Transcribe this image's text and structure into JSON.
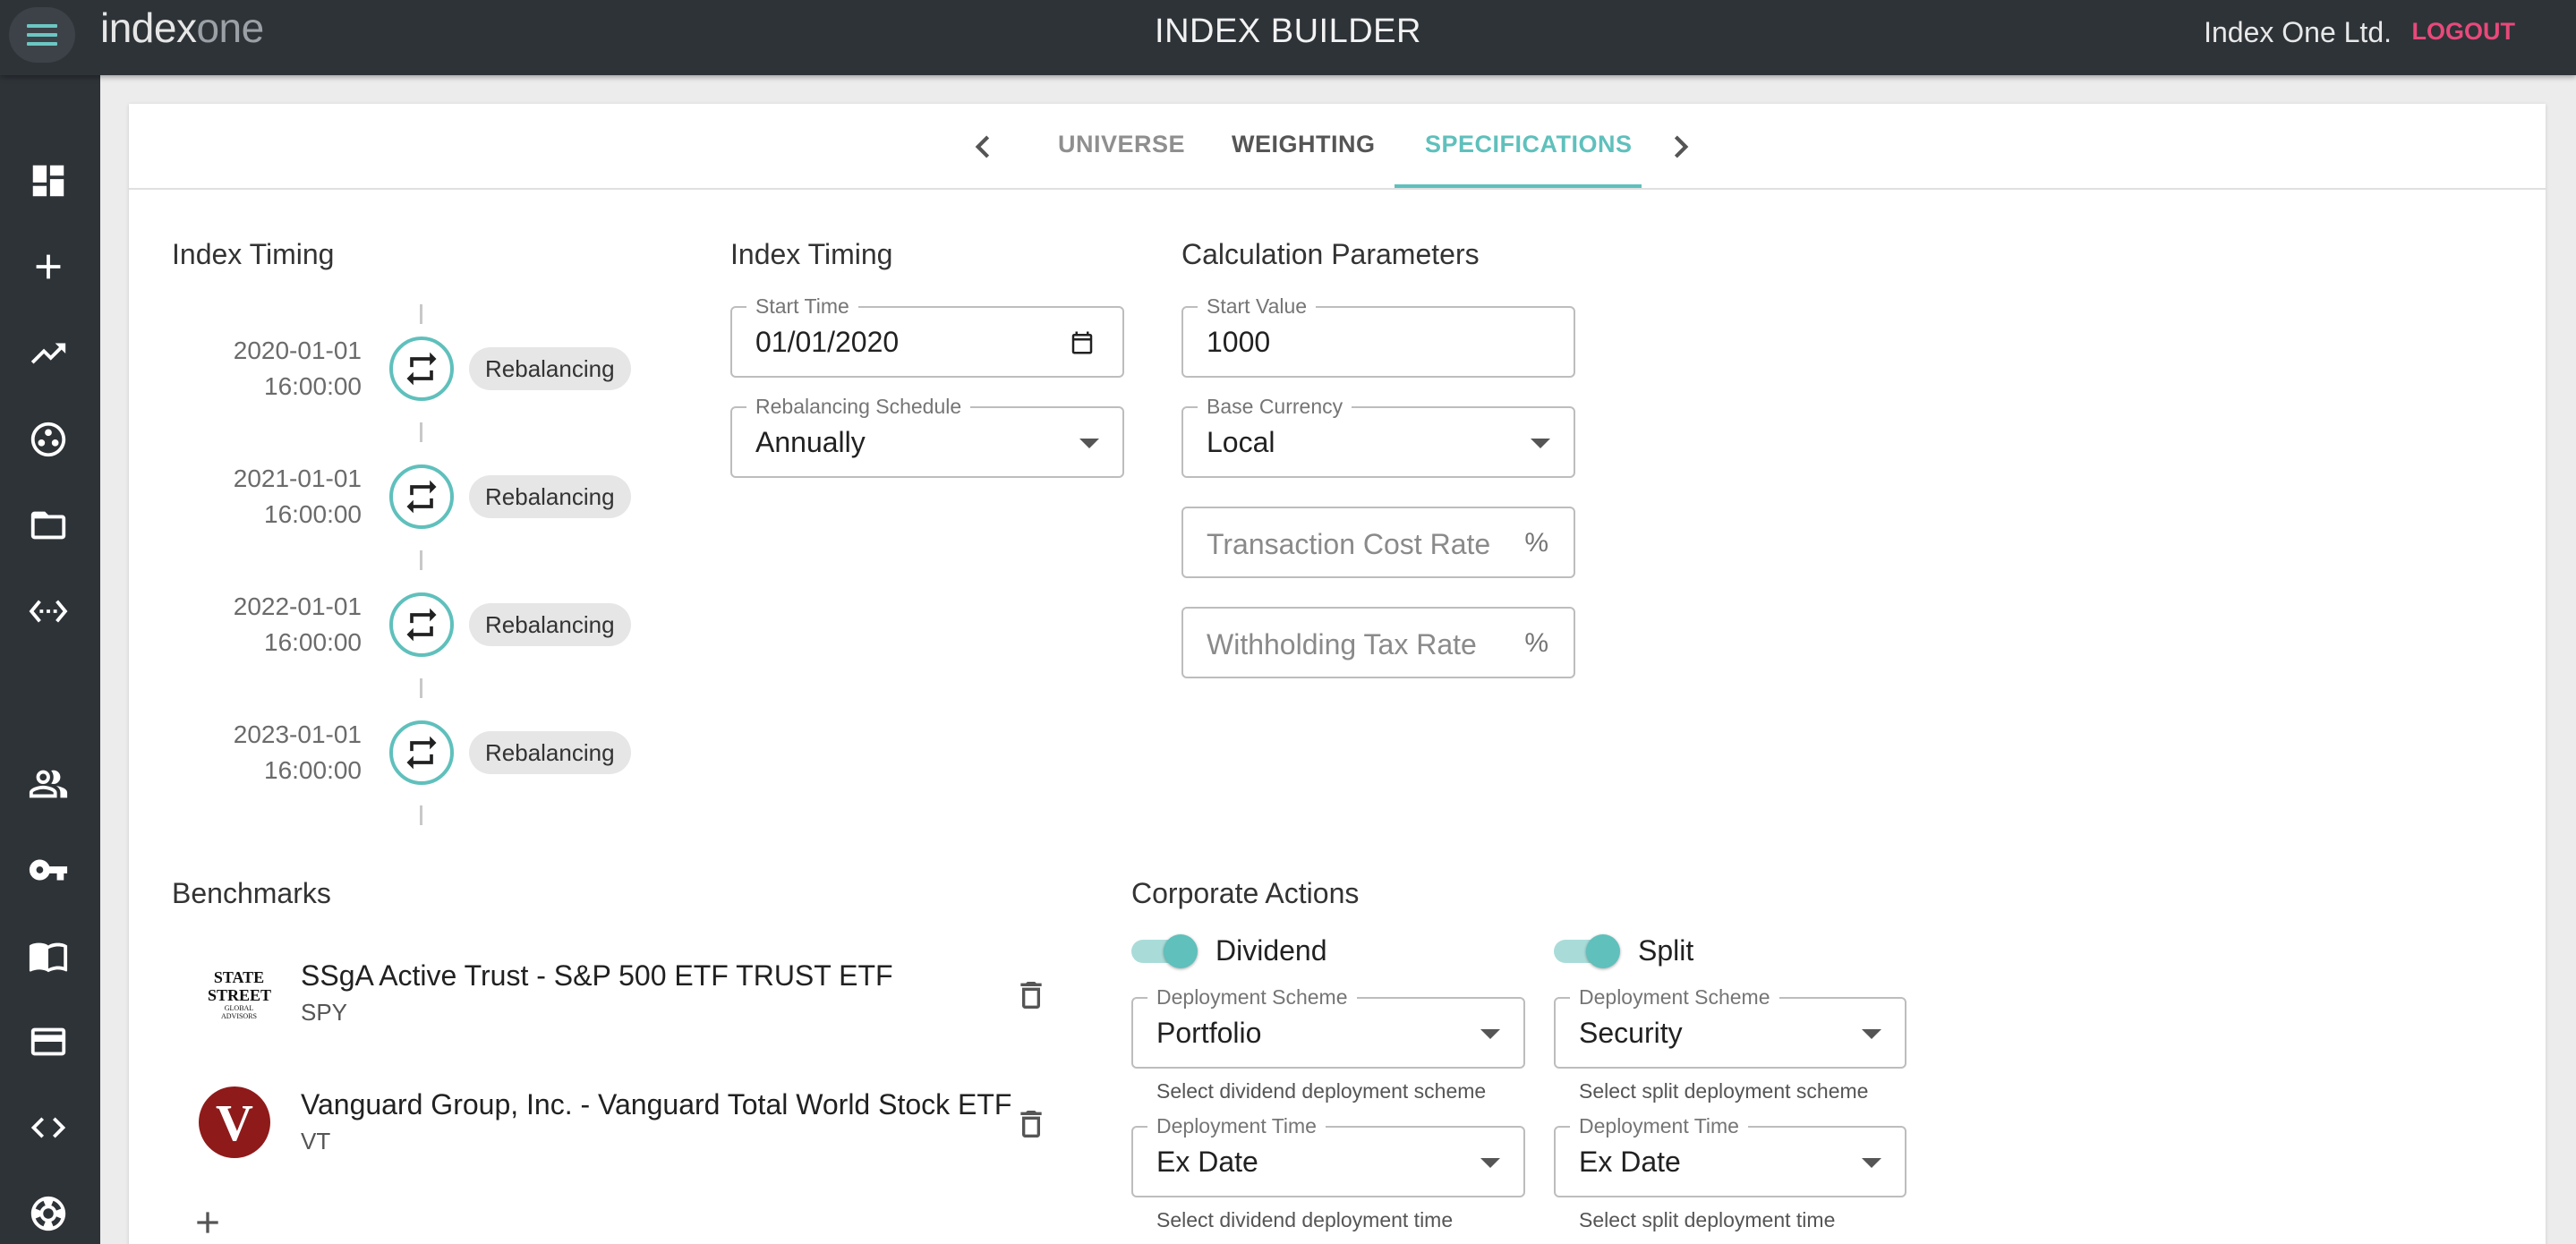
{
  "header": {
    "logo_main": "index",
    "logo_accent": "one",
    "title": "INDEX BUILDER",
    "company": "Index One Ltd.",
    "logout": "LOGOUT"
  },
  "sidebar": {
    "icons": [
      "dashboard-icon",
      "plus-icon",
      "trending-up-icon",
      "hub-icon",
      "folder-icon",
      "api-icon",
      "users-icon",
      "key-icon",
      "book-icon",
      "credit-card-icon",
      "code-icon",
      "support-icon"
    ]
  },
  "tabs": {
    "items": [
      "UNIVERSE",
      "WEIGHTING",
      "SPECIFICATIONS"
    ],
    "active": "SPECIFICATIONS"
  },
  "timeline": {
    "title": "Index Timing",
    "events": [
      {
        "date": "2020-01-01",
        "time": "16:00:00",
        "label": "Rebalancing"
      },
      {
        "date": "2021-01-01",
        "time": "16:00:00",
        "label": "Rebalancing"
      },
      {
        "date": "2022-01-01",
        "time": "16:00:00",
        "label": "Rebalancing"
      },
      {
        "date": "2023-01-01",
        "time": "16:00:00",
        "label": "Rebalancing"
      }
    ]
  },
  "index_timing": {
    "title": "Index Timing",
    "start_time_label": "Start Time",
    "start_time_value": "01/01/2020",
    "schedule_label": "Rebalancing Schedule",
    "schedule_value": "Annually"
  },
  "calc_params": {
    "title": "Calculation Parameters",
    "start_value_label": "Start Value",
    "start_value": "1000",
    "base_currency_label": "Base Currency",
    "base_currency": "Local",
    "transaction_cost_placeholder": "Transaction Cost Rate",
    "withholding_tax_placeholder": "Withholding Tax Rate",
    "percent": "%"
  },
  "benchmarks": {
    "title": "Benchmarks",
    "items": [
      {
        "name": "SSgA Active Trust - S&P 500 ETF TRUST ETF",
        "ticker": "SPY",
        "logo_text_1": "STATE",
        "logo_text_2": "STREET",
        "logo_text_3": "GLOBAL",
        "logo_text_4": "ADVISORS"
      },
      {
        "name": "Vanguard Group, Inc. - Vanguard Total World Stock ETF",
        "ticker": "VT",
        "logo_text_1": "V"
      }
    ]
  },
  "corporate_actions": {
    "title": "Corporate Actions",
    "dividend": {
      "label": "Dividend",
      "enabled": true,
      "scheme_label": "Deployment Scheme",
      "scheme_value": "Portfolio",
      "scheme_helper": "Select dividend deployment scheme",
      "time_label": "Deployment Time",
      "time_value": "Ex Date",
      "time_helper": "Select dividend deployment time"
    },
    "split": {
      "label": "Split",
      "enabled": true,
      "scheme_label": "Deployment Scheme",
      "scheme_value": "Security",
      "scheme_helper": "Select split deployment scheme",
      "time_label": "Deployment Time",
      "time_value": "Ex Date",
      "time_helper": "Select split deployment time"
    }
  },
  "colors": {
    "accent": "#5fc0bc",
    "logout": "#e8497a",
    "topbar": "#2e3338"
  }
}
